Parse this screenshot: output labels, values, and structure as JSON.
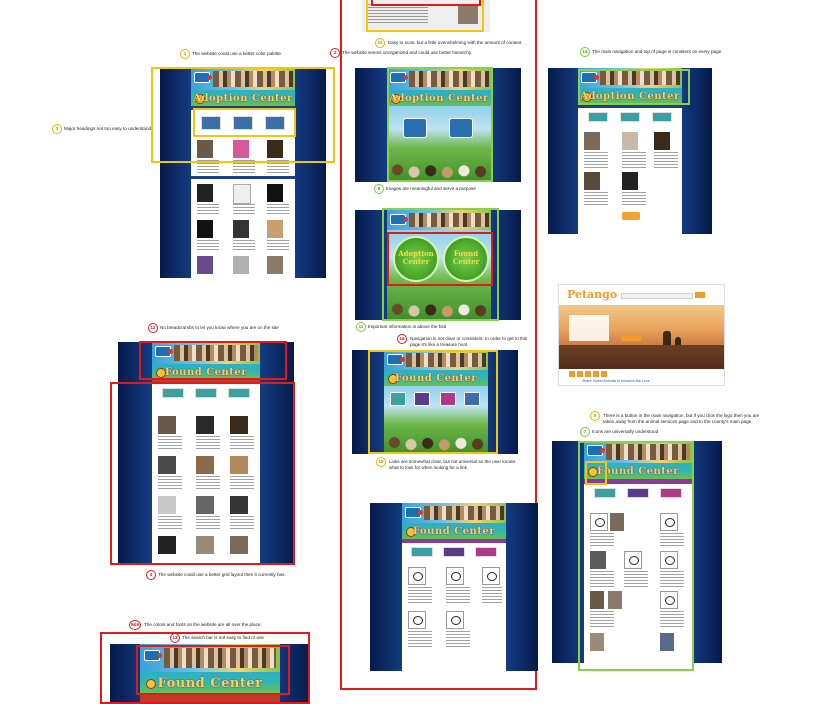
{
  "annotations": {
    "n1": {
      "num": "1",
      "text": "The website could use a better color palette."
    },
    "n3": {
      "num": "3",
      "text": "Major headings not too easy to understand"
    },
    "n2": {
      "num": "2",
      "text": "The website seems unorganized and could use better hierarchy."
    },
    "n15": {
      "num": "15",
      "text": "Easy to scan, but a little overwhelming with the amount of content."
    },
    "n14": {
      "num": "14",
      "text": "The main navigation and top of page is consitent on every page"
    },
    "n8": {
      "num": "8",
      "text": "Images are meaningful and serve a purpose"
    },
    "n11": {
      "num": "11",
      "text": "Important information is above the fold"
    },
    "n16": {
      "num": "16",
      "text": "Navigation is not clear or consistent. In order to get to this page it's like a treasure hunt"
    },
    "n12": {
      "num": "12",
      "text": "No breadcrumbs to let you know where you are on the site"
    },
    "n10": {
      "num": "10",
      "text": "Links are somewhat clear, but not universal so the user knows what to look for when looking for a link."
    },
    "n4": {
      "num": "4",
      "text": "The website could use a better grid layout then it currently has."
    },
    "n9": {
      "num": "9",
      "text": "There is a button in the main navigation, but if you click the logo then you are taken away from the animal services page and to the county's main page."
    },
    "n7": {
      "num": "7",
      "text": "Icons are universally understood"
    },
    "n5": {
      "num": "5&6",
      "text": "The colors and fonts on the website are all over the place."
    },
    "n13": {
      "num": "13",
      "text": "The search bar is not easy to find or use"
    }
  },
  "sites": {
    "adoption_label": "Adoption Center",
    "found_label": "Found Center"
  },
  "petango": {
    "logo": "Petango",
    "footer_link": "Share Sweet Animals to enhance the Love"
  },
  "colors": {
    "yellow": "#f2c60a",
    "green": "#88d24a",
    "red": "#e01b1b",
    "site_blue": "#0d2a66"
  }
}
